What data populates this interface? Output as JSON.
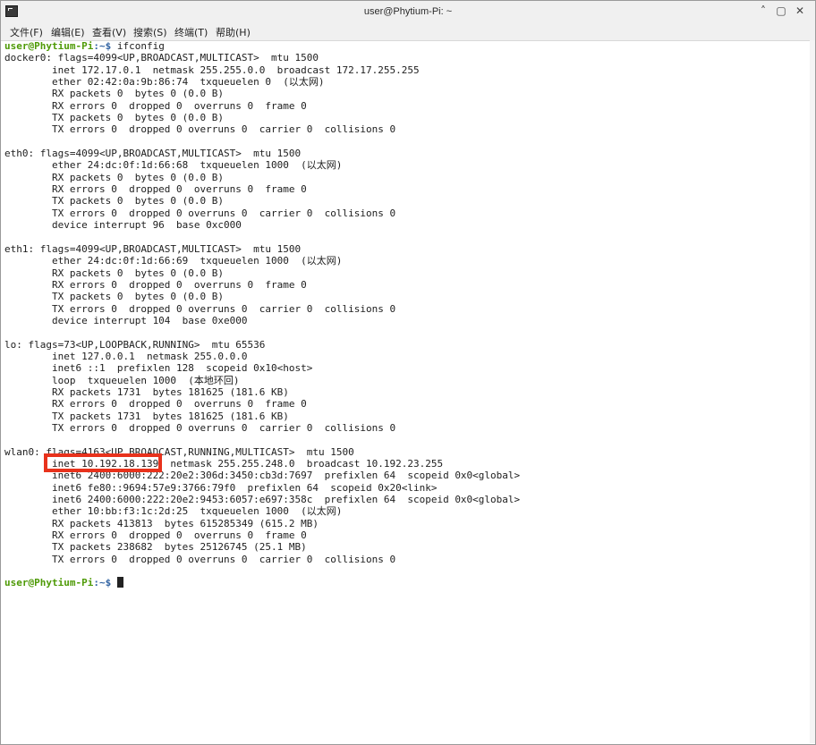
{
  "window": {
    "title": "user@Phytium-Pi: ~",
    "controls": {
      "minimize": "˄",
      "maximize": "▢",
      "close": "✕"
    }
  },
  "menu": [
    "文件(F)",
    "编辑(E)",
    "查看(V)",
    "搜索(S)",
    "终端(T)",
    "帮助(H)"
  ],
  "terminal": {
    "prompt_user": "user@Phytium-Pi",
    "prompt_path": ":~$",
    "command": " ifconfig",
    "lines": [
      "docker0: flags=4099<UP,BROADCAST,MULTICAST>  mtu 1500",
      "        inet 172.17.0.1  netmask 255.255.0.0  broadcast 172.17.255.255",
      "        ether 02:42:0a:9b:86:74  txqueuelen 0  (以太网)",
      "        RX packets 0  bytes 0 (0.0 B)",
      "        RX errors 0  dropped 0  overruns 0  frame 0",
      "        TX packets 0  bytes 0 (0.0 B)",
      "        TX errors 0  dropped 0 overruns 0  carrier 0  collisions 0",
      "",
      "eth0: flags=4099<UP,BROADCAST,MULTICAST>  mtu 1500",
      "        ether 24:dc:0f:1d:66:68  txqueuelen 1000  (以太网)",
      "        RX packets 0  bytes 0 (0.0 B)",
      "        RX errors 0  dropped 0  overruns 0  frame 0",
      "        TX packets 0  bytes 0 (0.0 B)",
      "        TX errors 0  dropped 0 overruns 0  carrier 0  collisions 0",
      "        device interrupt 96  base 0xc000",
      "",
      "eth1: flags=4099<UP,BROADCAST,MULTICAST>  mtu 1500",
      "        ether 24:dc:0f:1d:66:69  txqueuelen 1000  (以太网)",
      "        RX packets 0  bytes 0 (0.0 B)",
      "        RX errors 0  dropped 0  overruns 0  frame 0",
      "        TX packets 0  bytes 0 (0.0 B)",
      "        TX errors 0  dropped 0 overruns 0  carrier 0  collisions 0",
      "        device interrupt 104  base 0xe000",
      "",
      "lo: flags=73<UP,LOOPBACK,RUNNING>  mtu 65536",
      "        inet 127.0.0.1  netmask 255.0.0.0",
      "        inet6 ::1  prefixlen 128  scopeid 0x10<host>",
      "        loop  txqueuelen 1000  (本地环回)",
      "        RX packets 1731  bytes 181625 (181.6 KB)",
      "        RX errors 0  dropped 0  overruns 0  frame 0",
      "        TX packets 1731  bytes 181625 (181.6 KB)",
      "        TX errors 0  dropped 0 overruns 0  carrier 0  collisions 0",
      "",
      "wlan0: flags=4163<UP,BROADCAST,RUNNING,MULTICAST>  mtu 1500",
      "        inet 10.192.18.139  netmask 255.255.248.0  broadcast 10.192.23.255",
      "        inet6 2400:6000:222:20e2:306d:3450:cb3d:7697  prefixlen 64  scopeid 0x0<global>",
      "        inet6 fe80::9694:57e9:3766:79f0  prefixlen 64  scopeid 0x20<link>",
      "        inet6 2400:6000:222:20e2:9453:6057:e697:358c  prefixlen 64  scopeid 0x0<global>",
      "        ether 10:bb:f3:1c:2d:25  txqueuelen 1000  (以太网)",
      "        RX packets 413813  bytes 615285349 (615.2 MB)",
      "        RX errors 0  dropped 0  overruns 0  frame 0",
      "        TX packets 238682  bytes 25126745 (25.1 MB)",
      "        TX errors 0  dropped 0 overruns 0  carrier 0  collisions 0",
      ""
    ],
    "final_prompt_user": "user@Phytium-Pi",
    "final_prompt_path": ":~$ "
  },
  "colors": {
    "prompt_user": "#4e9a06",
    "prompt_path": "#3465a4",
    "highlight": "#e8321c"
  },
  "icons": [
    "terminal-app-icon",
    "minimize-icon",
    "maximize-icon",
    "close-icon",
    "cursor-block"
  ]
}
